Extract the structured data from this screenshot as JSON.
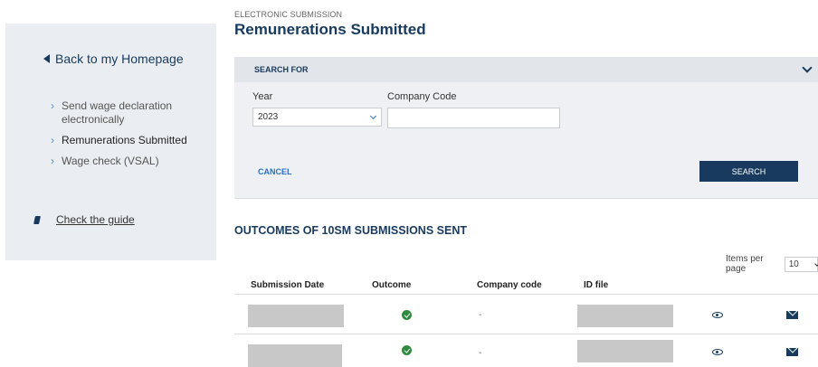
{
  "sidebar": {
    "back_label": "Back to my Homepage",
    "items": [
      {
        "label": "Send wage declaration electronically"
      },
      {
        "label": "Remunerations Submitted"
      },
      {
        "label": "Wage check (VSAL)"
      }
    ],
    "guide_label": "Check the guide"
  },
  "header": {
    "supertitle": "ELECTRONIC SUBMISSION",
    "title": "Remunerations Submitted"
  },
  "search": {
    "heading": "SEARCH FOR",
    "year_label": "Year",
    "year_value": "2023",
    "company_label": "Company Code",
    "company_value": "",
    "cancel_label": "CANCEL",
    "search_label": "SEARCH"
  },
  "outcomes": {
    "title": "OUTCOMES OF 10SM SUBMISSIONS SENT",
    "items_per_page_label": "Items per page",
    "items_per_page_value": "10",
    "columns": [
      "Submission Date",
      "Outcome",
      "Company code",
      "ID file"
    ],
    "rows": [
      {
        "company_code": "-"
      },
      {
        "company_code": "-"
      }
    ]
  },
  "colors": {
    "brand": "#173a5e",
    "accent": "#2a6fc9",
    "success": "#2e8b3d",
    "sidebar_bg": "#eaedf1"
  },
  "icons": [
    "caret-left-icon",
    "chevron-right-icon",
    "book-icon",
    "chevron-down-icon",
    "check-circle-icon",
    "eye-icon",
    "envelope-icon"
  ]
}
